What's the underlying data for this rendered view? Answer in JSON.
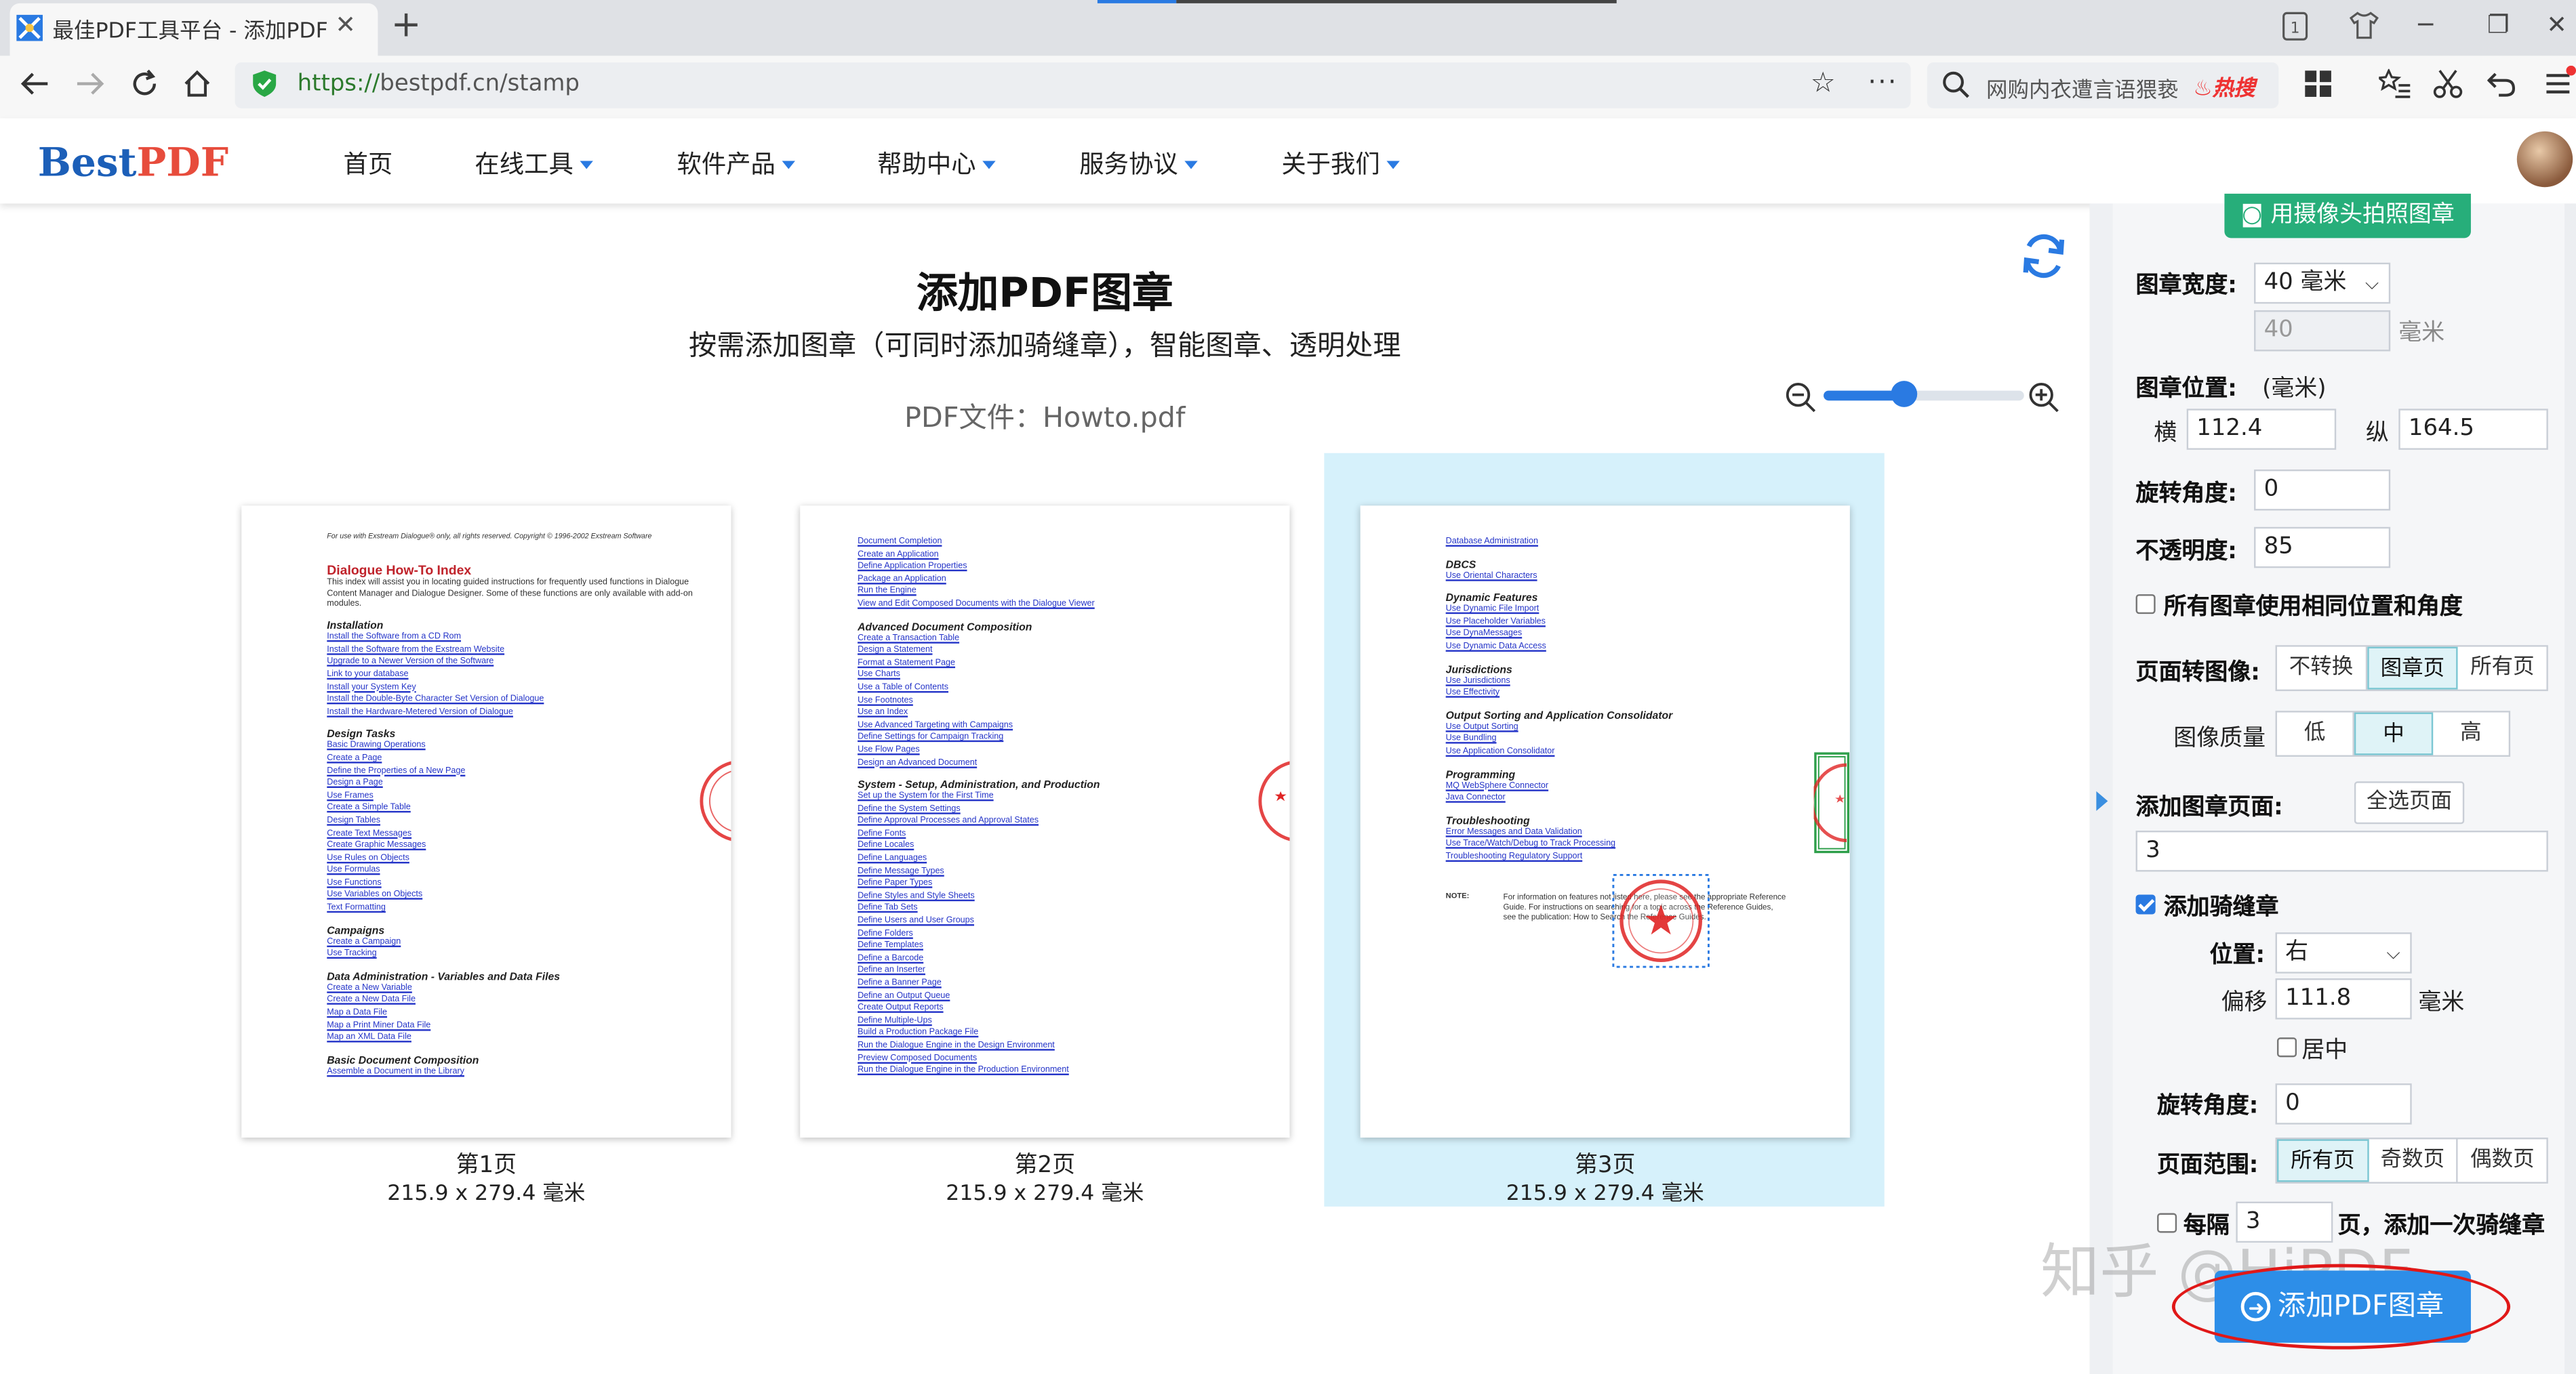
{
  "browser": {
    "tab_title": "最佳PDF工具平台 - 添加PDF图章",
    "url_scheme": "https://",
    "url_rest": "bestpdf.cn/stamp",
    "search_text": "网购内衣遭言语猥亵",
    "search_badge": "热搜"
  },
  "site": {
    "logo_a": "Best",
    "logo_b": "PDF",
    "nav": [
      "首页",
      "在线工具",
      "软件产品",
      "帮助中心",
      "服务协议",
      "关于我们"
    ]
  },
  "main": {
    "title": "添加PDF图章",
    "subtitle": "按需添加图章（可同时添加骑缝章），智能图章、透明处理",
    "filename": "PDF文件：Howto.pdf",
    "zoom_level": 0.4,
    "pages": [
      {
        "label": "第1页",
        "size": "215.9 x 279.4 毫米"
      },
      {
        "label": "第2页",
        "size": "215.9 x 279.4 毫米"
      },
      {
        "label": "第3页",
        "size": "215.9 x 279.4 毫米"
      }
    ],
    "page1": {
      "header": "For use with Exstream Dialogue® only, all rights reserved. Copyright © 1996-2002 Exstream Software",
      "title": "Dialogue How-To Index",
      "intro": [
        "This index will assist you in locating guided instructions for frequently used functions in Dialogue",
        "Content Manager and Dialogue Designer. Some of these functions are only available with add-on",
        "modules."
      ],
      "sections": [
        {
          "h": "Installation",
          "items": [
            "Install the Software from a CD Rom",
            "Install the Software from the Exstream Website",
            "Upgrade to a Newer Version of the Software",
            "Link to your database",
            "Install your System Key",
            "Install the Double-Byte Character Set Version of Dialogue",
            "Install the Hardware-Metered Version of Dialogue"
          ]
        },
        {
          "h": "Design Tasks",
          "items": [
            "Basic Drawing Operations",
            "Create a Page",
            "Define the Properties of a New Page",
            "Design a Page",
            "Use Frames",
            "Create a Simple Table",
            "Design Tables",
            "Create Text Messages",
            "Create Graphic Messages",
            "Use Rules on Objects",
            "Use Formulas",
            "Use Functions",
            "Use Variables on Objects",
            "Text Formatting"
          ]
        },
        {
          "h": "Campaigns",
          "items": [
            "Create a Campaign",
            "Use Tracking"
          ]
        },
        {
          "h": "Data Administration - Variables and Data Files",
          "items": [
            "Create a New Variable",
            "Create a New Data File",
            "Map a Data File",
            "Map a Print Miner Data File",
            "Map an XML Data File"
          ]
        },
        {
          "h": "Basic Document Composition",
          "items": [
            "Assemble a Document in the Library"
          ]
        }
      ]
    },
    "page2": {
      "sections": [
        {
          "h": "",
          "items": [
            "Document Completion",
            "Create an Application",
            "Define Application Properties",
            "Package an Application",
            "Run the Engine",
            "View and Edit Composed Documents with the Dialogue Viewer"
          ]
        },
        {
          "h": "Advanced Document Composition",
          "items": [
            "Create a Transaction Table",
            "Design a Statement",
            "Format a Statement Page",
            "Use Charts",
            "Use a Table of Contents",
            "Use Footnotes",
            "Use an Index",
            "Use Advanced Targeting with Campaigns",
            "Define Settings for Campaign Tracking",
            "Use Flow Pages",
            "Design an Advanced Document"
          ]
        },
        {
          "h": "System - Setup, Administration, and Production",
          "items": [
            "Set up the System for the First Time",
            "Define the System Settings",
            "Define Approval Processes and Approval States",
            "Define Fonts",
            "Define Locales",
            "Define Languages",
            "Define Message Types",
            "Define Paper Types",
            "Define Styles and Style Sheets",
            "Define Tab Sets",
            "Define Users and User Groups",
            "Define Folders",
            "Define Templates",
            "Define a Barcode",
            "Define an Inserter",
            "Define a Banner Page",
            "Define an Output Queue",
            "Create Output Reports",
            "Define Multiple-Ups",
            "Build a Production Package File",
            "Run the Dialogue Engine in the Design Environment",
            "Preview Composed Documents",
            "Run the Dialogue Engine in the Production Environment"
          ]
        }
      ]
    },
    "page3": {
      "sections": [
        {
          "h": "",
          "items": [
            "Database Administration"
          ]
        },
        {
          "h": "DBCS",
          "items": [
            "Use Oriental Characters"
          ]
        },
        {
          "h": "Dynamic Features",
          "items": [
            "Use Dynamic File Import",
            "Use Placeholder Variables",
            "Use DynaMessages",
            "Use Dynamic Data Access"
          ]
        },
        {
          "h": "Jurisdictions",
          "items": [
            "Use Jurisdictions",
            "Use Effectivity"
          ]
        },
        {
          "h": "Output Sorting and Application Consolidator",
          "items": [
            "Use Output Sorting",
            "Use Bundling",
            "Use Application Consolidator"
          ]
        },
        {
          "h": "Programming",
          "items": [
            "MQ WebSphere Connector",
            "Java Connector"
          ]
        },
        {
          "h": "Troubleshooting",
          "items": [
            "Error Messages and Data Validation",
            "Use Trace/Watch/Debug to Track Processing",
            "Troubleshooting Regulatory Support"
          ]
        }
      ],
      "note_label": "NOTE:",
      "note": [
        "For information on features not listed here, please see the appropriate Reference",
        "Guide. For instructions on searching for a topic across the Reference Guides,",
        "see the publication: How to Search the Reference Guides."
      ]
    }
  },
  "panel": {
    "camera_button": "用摄像头拍照图章",
    "width_label": "图章宽度:",
    "width_value": "40 毫米",
    "width_custom": "40",
    "unit_mm": "毫米",
    "position_label": "图章位置:",
    "position_unit": "(毫米)",
    "x_label": "横",
    "x_value": "112.4",
    "y_label": "纵",
    "y_value": "164.5",
    "rotation_label": "旋转角度:",
    "rotation_value": "0",
    "opacity_label": "不透明度:",
    "opacity_value": "85",
    "same_position_label": "所有图章使用相同位置和角度",
    "convert_label": "页面转图像:",
    "convert_options": [
      "不转换",
      "图章页",
      "所有页"
    ],
    "quality_label": "图像质量",
    "quality_options": [
      "低",
      "中",
      "高"
    ],
    "pages_label": "添加图章页面:",
    "select_all": "全选页面",
    "pages_value": "3",
    "perforation_label": "添加骑缝章",
    "perf_position_label": "位置:",
    "perf_position_value": "右",
    "offset_label": "偏移",
    "offset_value": "111.8",
    "center_label": "居中",
    "perf_rotation_label": "旋转角度:",
    "perf_rotation_value": "0",
    "range_label": "页面范围:",
    "range_options": [
      "所有页",
      "奇数页",
      "偶数页"
    ],
    "every_label": "每隔",
    "every_value": "3",
    "every_suffix": "页，添加一次骑缝章",
    "submit": "添加PDF图章"
  },
  "overlay": {
    "watermark": "知乎 @HiPDF"
  },
  "colors": {
    "accent": "#2a7ae2",
    "green": "#27ae7a",
    "highlight": "#d6f1fb",
    "stamp_red": "#e02424"
  }
}
